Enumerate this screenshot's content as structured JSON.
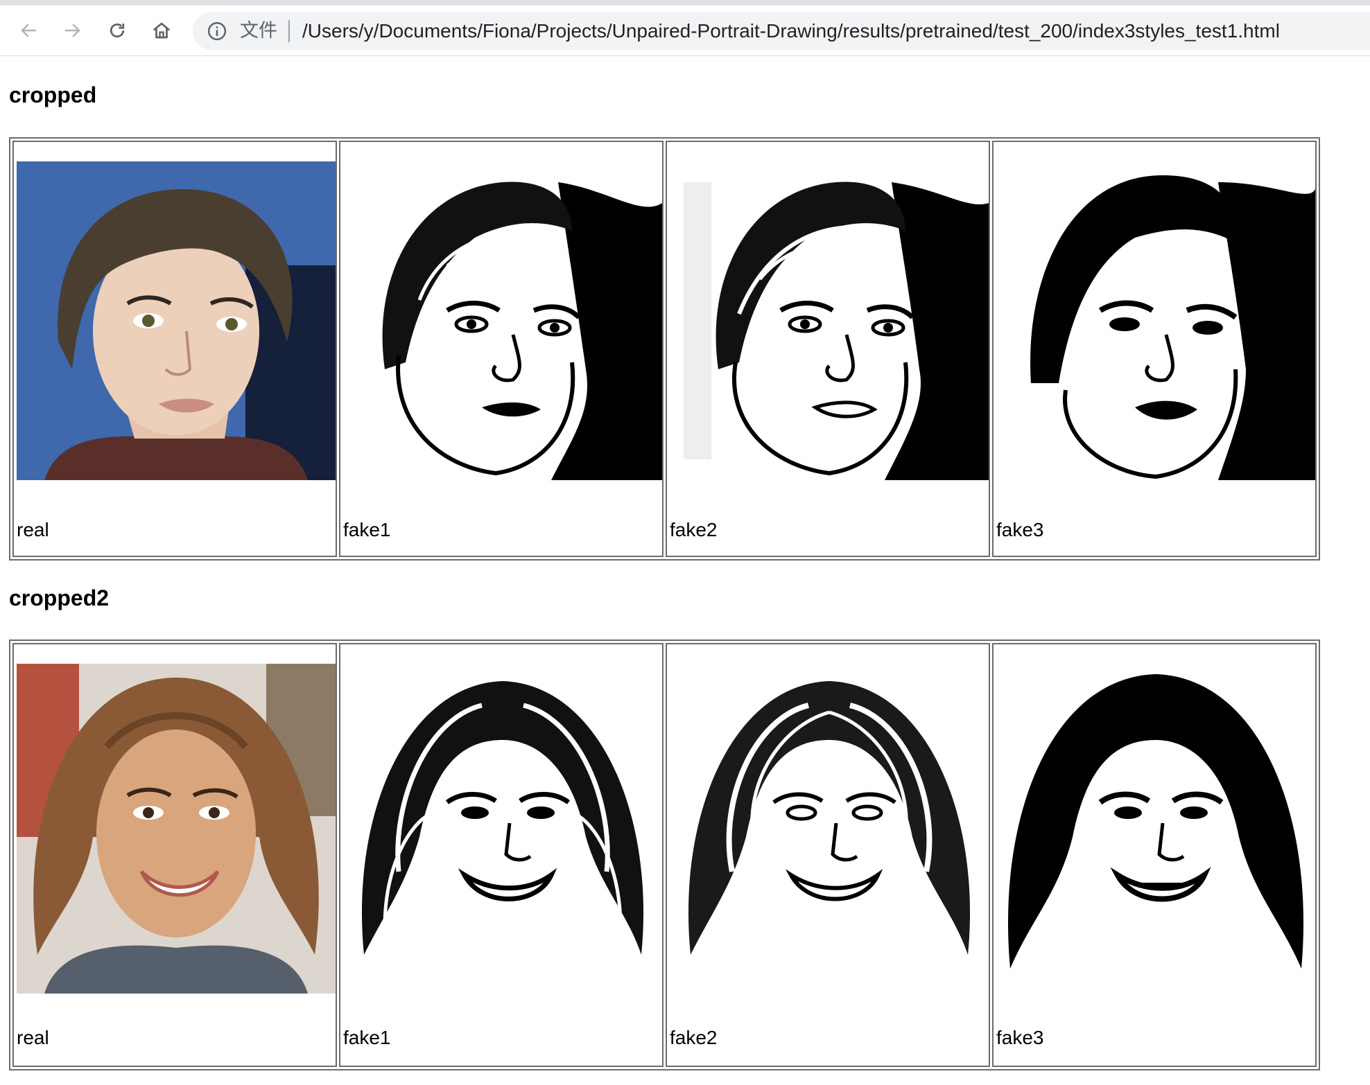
{
  "browser": {
    "scheme_label": "文件",
    "url": "/Users/y/Documents/Fiona/Projects/Unpaired-Portrait-Drawing/results/pretrained/test_200/index3styles_test1.html",
    "icons": [
      "back-arrow-icon",
      "forward-arrow-icon",
      "reload-icon",
      "home-icon",
      "info-icon"
    ]
  },
  "sections": [
    {
      "title": "cropped",
      "cells": [
        {
          "label": "real",
          "image": "color-photo-short-hair-portrait"
        },
        {
          "label": "fake1",
          "image": "line-drawing-short-hair-portrait"
        },
        {
          "label": "fake2",
          "image": "line-drawing-short-hair-portrait"
        },
        {
          "label": "fake3",
          "image": "line-drawing-short-hair-portrait"
        }
      ]
    },
    {
      "title": "cropped2",
      "cells": [
        {
          "label": "real",
          "image": "color-photo-long-hair-smiling-portrait"
        },
        {
          "label": "fake1",
          "image": "line-drawing-long-hair-portrait"
        },
        {
          "label": "fake2",
          "image": "line-drawing-long-hair-portrait"
        },
        {
          "label": "fake3",
          "image": "line-drawing-long-hair-portrait"
        }
      ]
    }
  ]
}
